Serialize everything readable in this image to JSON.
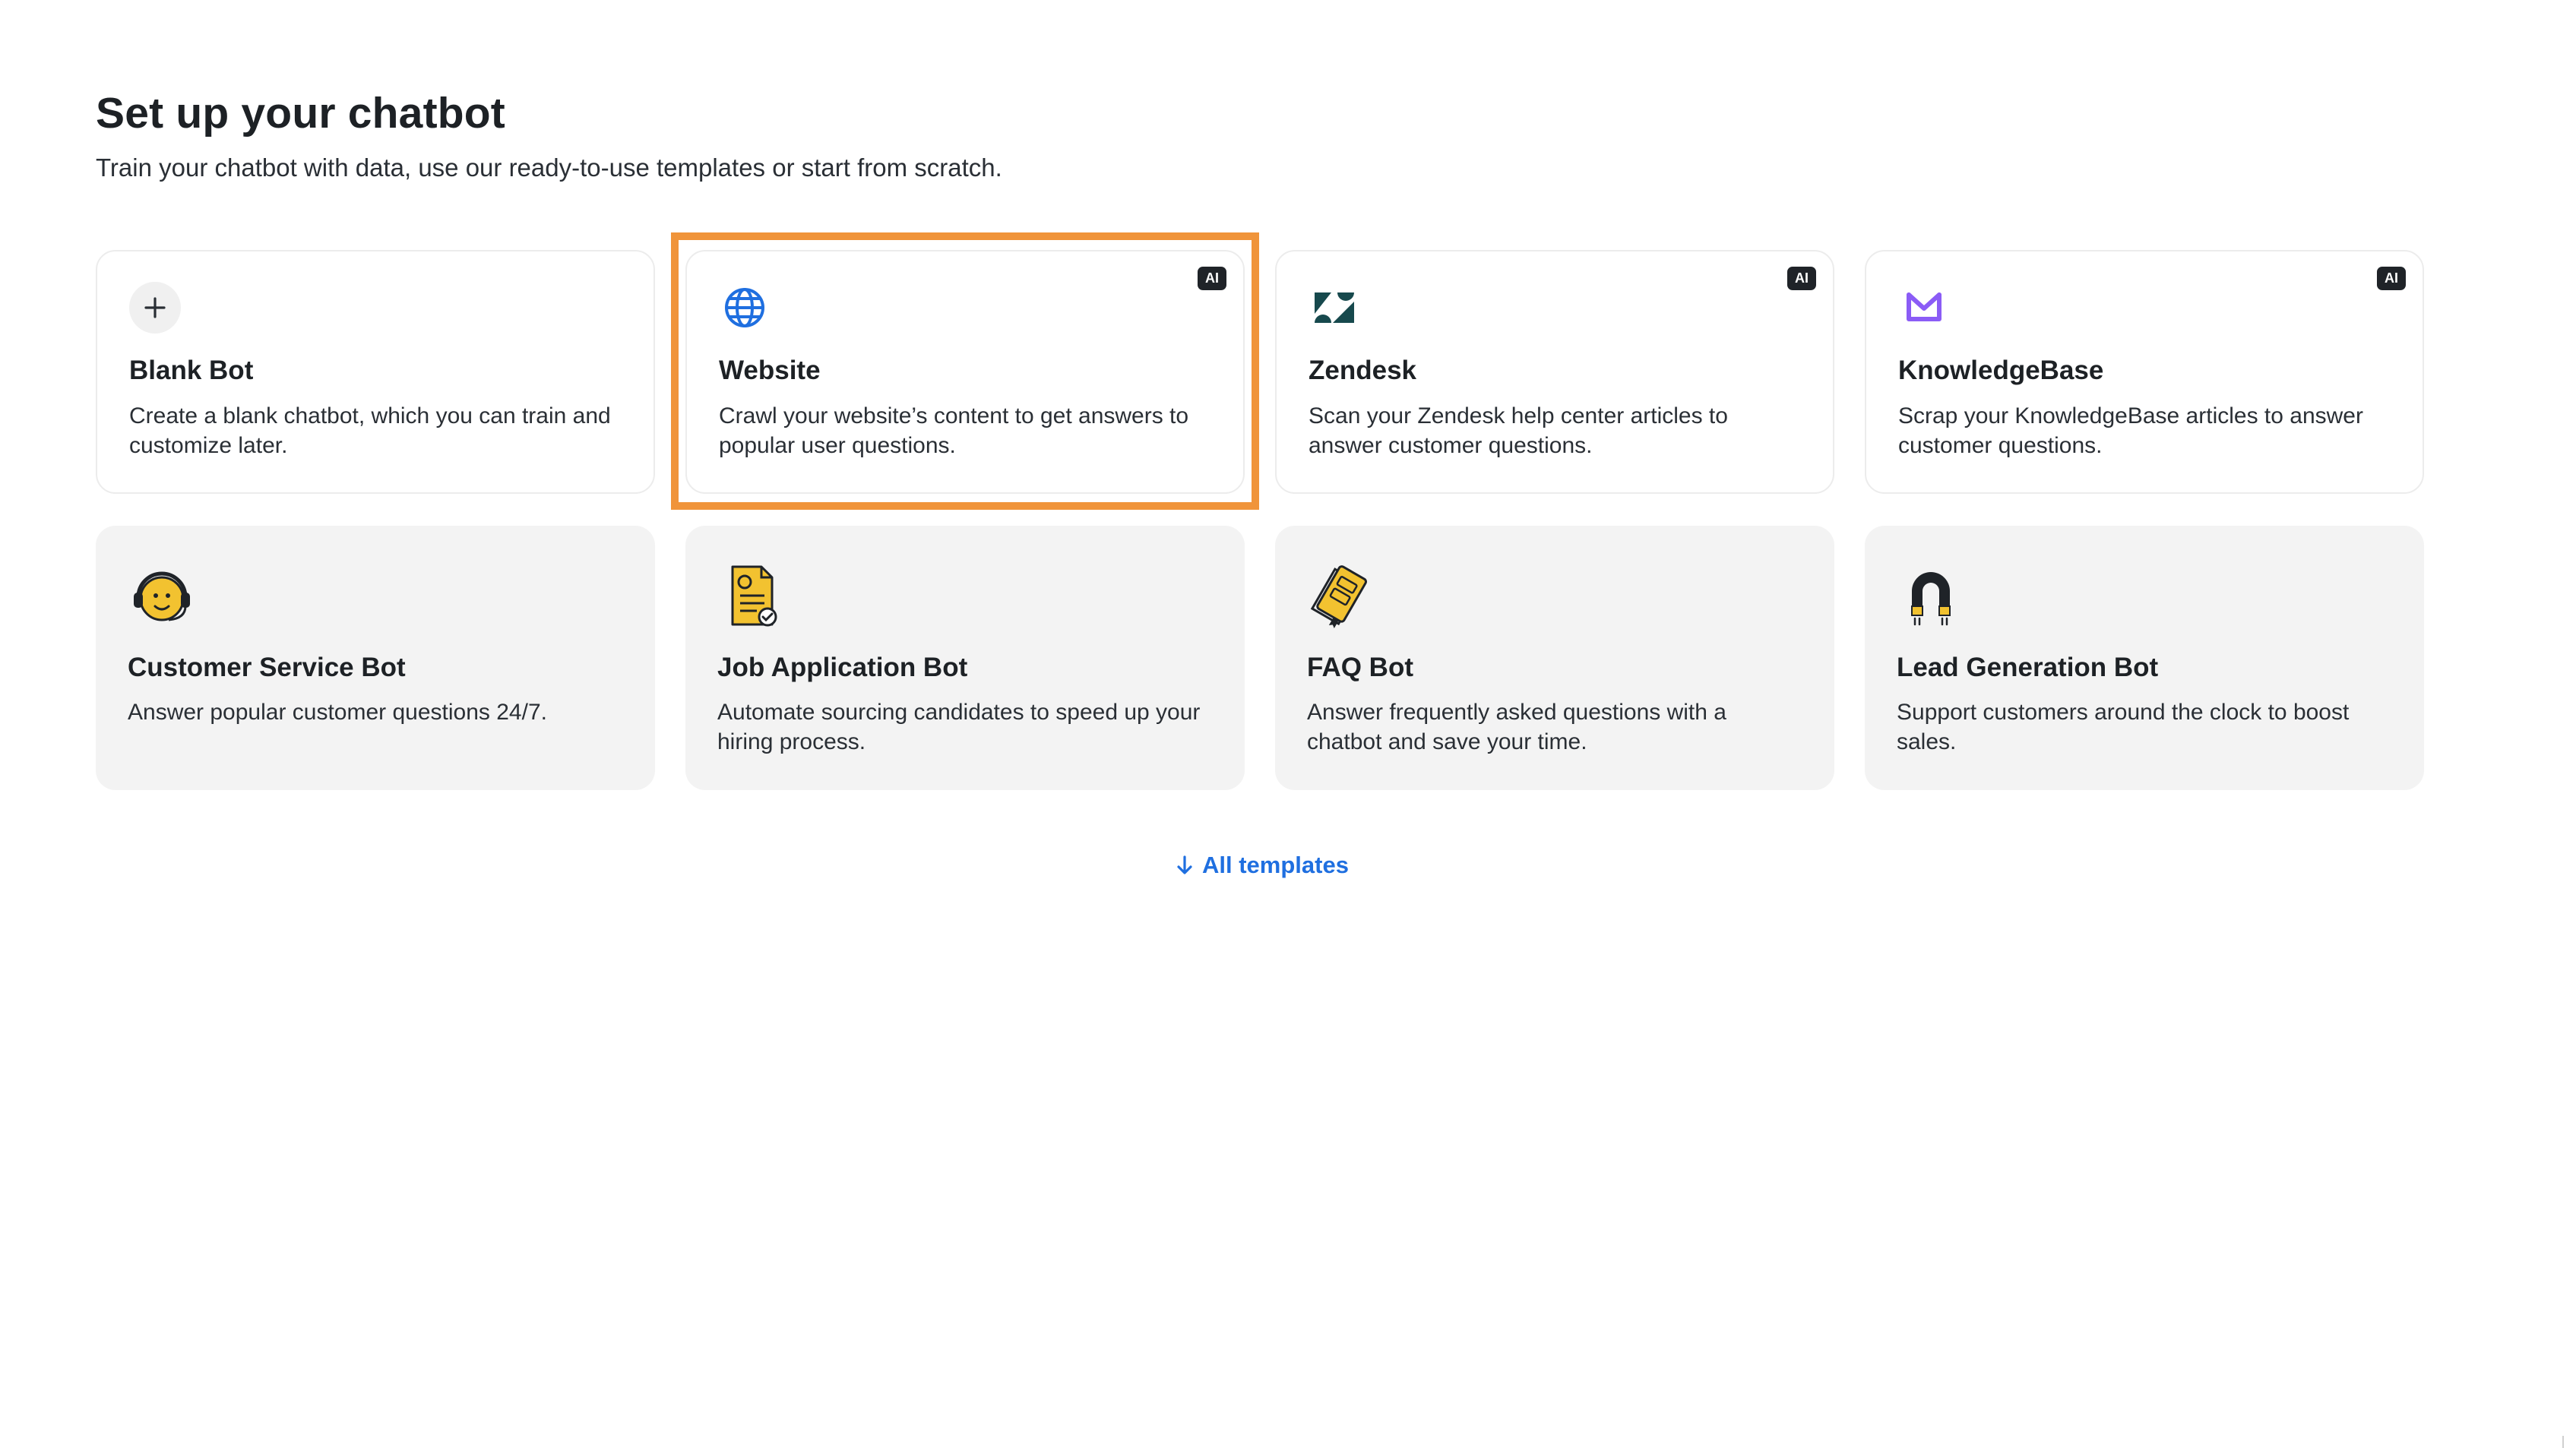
{
  "header": {
    "title": "Set up your chatbot",
    "subtitle": "Train your chatbot with data, use our ready-to-use templates or start from scratch."
  },
  "sources": [
    {
      "title": "Blank Bot",
      "description": "Create a blank chatbot, which you can train and customize later.",
      "icon": "plus-icon",
      "ai": false
    },
    {
      "title": "Website",
      "description": "Crawl your website’s content to get answers to popular user questions.",
      "icon": "globe-icon",
      "ai": true,
      "badge": "AI",
      "highlighted": true
    },
    {
      "title": "Zendesk",
      "description": "Scan your Zendesk help center articles to answer customer questions.",
      "icon": "zendesk-logo-icon",
      "ai": true,
      "badge": "AI"
    },
    {
      "title": "KnowledgeBase",
      "description": "Scrap your KnowledgeBase articles to answer customer questions.",
      "icon": "knowledgebase-logo-icon",
      "ai": true,
      "badge": "AI"
    }
  ],
  "templates": [
    {
      "title": "Customer Service Bot",
      "description": "Answer popular customer questions 24/7.",
      "icon": "headset-face-icon"
    },
    {
      "title": "Job Application Bot",
      "description": "Automate sourcing candidates to speed up your hiring process.",
      "icon": "resume-document-icon"
    },
    {
      "title": "FAQ Bot",
      "description": "Answer frequently asked questions with a chatbot and save your time.",
      "icon": "faq-book-icon"
    },
    {
      "title": "Lead Generation Bot",
      "description": "Support customers around the clock to boost sales.",
      "icon": "magnet-icon"
    }
  ],
  "footer": {
    "all_templates_label": "All templates",
    "icon": "arrow-down-icon"
  },
  "colors": {
    "accent": "#1f6fe0",
    "highlight": "#f0943a",
    "template_card_bg": "#f3f3f3",
    "knowledgebase_purple": "#8b5cf6",
    "illustration_yellow": "#f2c230"
  }
}
